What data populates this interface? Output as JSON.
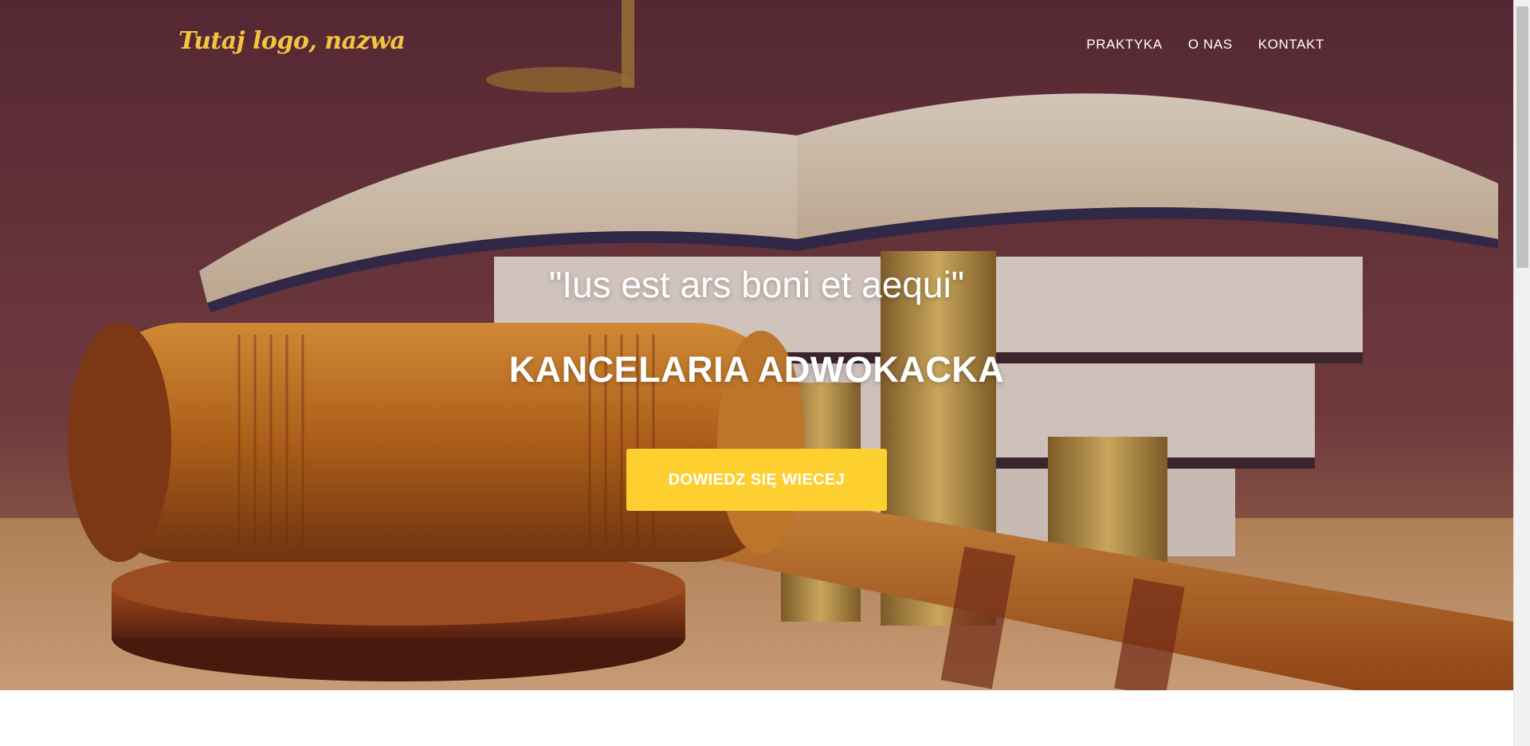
{
  "header": {
    "logo_text": "Tutaj logo, nazwa",
    "nav": [
      {
        "label": "PRAKTYKA"
      },
      {
        "label": "O NAS"
      },
      {
        "label": "KONTAKT"
      }
    ]
  },
  "hero": {
    "quote": "\"Ius est ars boni et aequi\"",
    "headline": "KANCELARIA ADWOKACKA",
    "cta_label": "DOWIEDZ SIĘ WIECEJ",
    "background_image": "gavel-books-coins-photo"
  },
  "colors": {
    "accent": "#fdcf2f",
    "logo": "#f2c440",
    "text_on_hero": "#ffffff"
  }
}
